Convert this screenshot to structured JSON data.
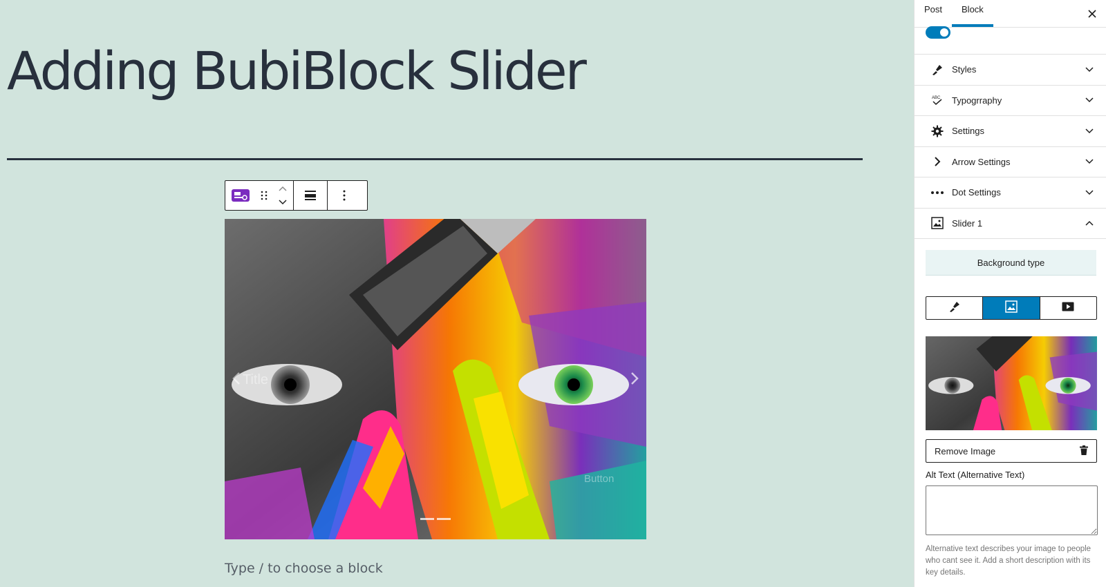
{
  "editor": {
    "post_title": "Adding BubiBlock Slider",
    "appender_placeholder": "Type / to choose a block",
    "slide": {
      "title_text": "Title",
      "button_text": "Button"
    }
  },
  "sidebar": {
    "tabs": [
      {
        "label": "Post",
        "active": false
      },
      {
        "label": "Block",
        "active": true
      }
    ],
    "panels": [
      {
        "label": "Styles",
        "icon": "brush-icon",
        "expanded": false
      },
      {
        "label": "Typogrraphy",
        "icon": "typography-icon",
        "expanded": false
      },
      {
        "label": "Settings",
        "icon": "gear-icon",
        "expanded": false
      },
      {
        "label": "Arrow Settings",
        "icon": "chevron-right-icon",
        "expanded": false
      },
      {
        "label": "Dot Settings",
        "icon": "dots-icon",
        "expanded": false
      },
      {
        "label": "Slider 1",
        "icon": "image-icon",
        "expanded": true
      }
    ],
    "background_type_label": "Background type",
    "background_type_options": [
      "brush-icon",
      "image-icon",
      "video-icon"
    ],
    "background_type_selected": "image-icon",
    "remove_image_label": "Remove Image",
    "alt_text_label": "Alt Text (Alternative Text)",
    "alt_text_value": "",
    "alt_text_help": "Alternative text describes your image to people who cant see it. Add a short description with its key details."
  },
  "colors": {
    "canvas_bg": "#d1e4dd",
    "accent": "#007cba",
    "block_icon": "#7b2cbf"
  }
}
